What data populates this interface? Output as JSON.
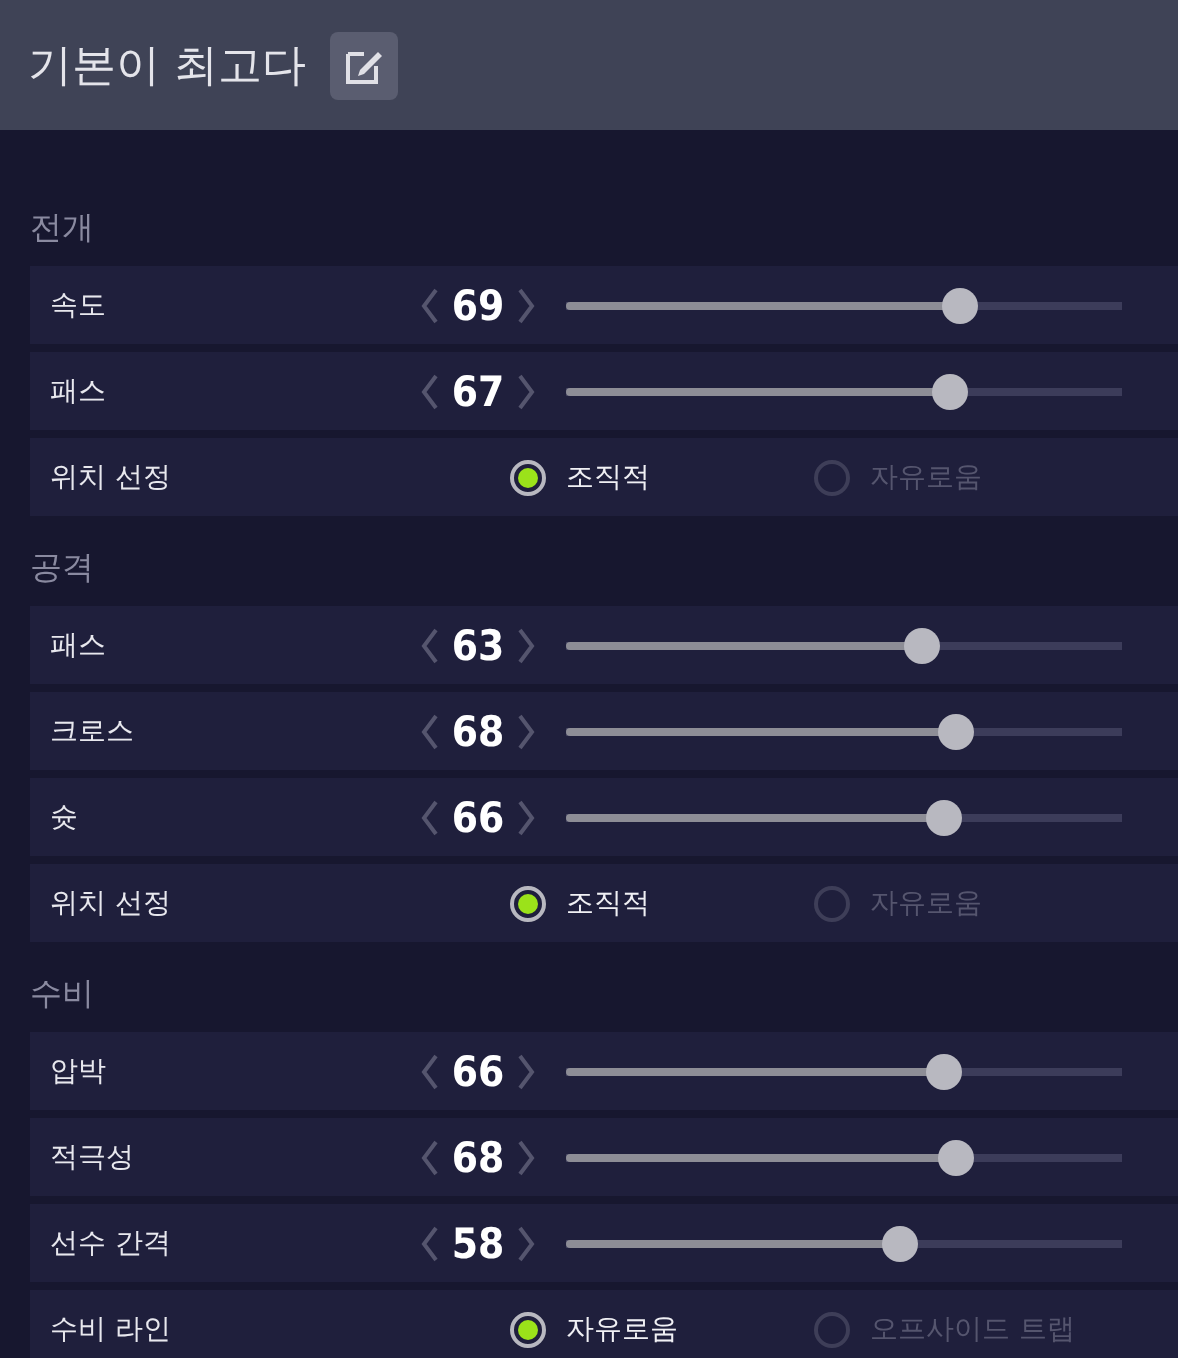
{
  "header": {
    "title": "기본이 최고다"
  },
  "sections": [
    {
      "title": "전개",
      "rows": [
        {
          "kind": "slider",
          "label": "속도",
          "value": "69",
          "level": 0.71
        },
        {
          "kind": "slider",
          "label": "패스",
          "value": "67",
          "level": 0.69
        },
        {
          "kind": "choice",
          "label": "위치 선정",
          "options": [
            {
              "label": "조직적",
              "selected": true
            },
            {
              "label": "자유로움",
              "selected": false
            }
          ]
        }
      ]
    },
    {
      "title": "공격",
      "rows": [
        {
          "kind": "slider",
          "label": "패스",
          "value": "63",
          "level": 0.64
        },
        {
          "kind": "slider",
          "label": "크로스",
          "value": "68",
          "level": 0.7
        },
        {
          "kind": "slider",
          "label": "슛",
          "value": "66",
          "level": 0.68
        },
        {
          "kind": "choice",
          "label": "위치 선정",
          "options": [
            {
              "label": "조직적",
              "selected": true
            },
            {
              "label": "자유로움",
              "selected": false
            }
          ]
        }
      ]
    },
    {
      "title": "수비",
      "rows": [
        {
          "kind": "slider",
          "label": "압박",
          "value": "66",
          "level": 0.68
        },
        {
          "kind": "slider",
          "label": "적극성",
          "value": "68",
          "level": 0.7
        },
        {
          "kind": "slider",
          "label": "선수 간격",
          "value": "58",
          "level": 0.6
        },
        {
          "kind": "choice",
          "label": "수비 라인",
          "options": [
            {
              "label": "자유로움",
              "selected": true
            },
            {
              "label": "오프사이드 트랩",
              "selected": false
            }
          ]
        }
      ]
    }
  ]
}
